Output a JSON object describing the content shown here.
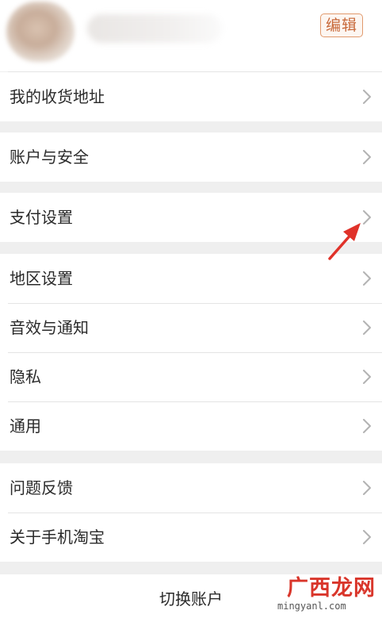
{
  "profile": {
    "edit_label": "编辑"
  },
  "menu": {
    "groups": [
      {
        "items": [
          {
            "label": "我的收货地址"
          }
        ]
      },
      {
        "items": [
          {
            "label": "账户与安全"
          }
        ]
      },
      {
        "items": [
          {
            "label": "支付设置"
          }
        ]
      },
      {
        "items": [
          {
            "label": "地区设置"
          },
          {
            "label": "音效与通知"
          },
          {
            "label": "隐私"
          },
          {
            "label": "通用"
          }
        ]
      },
      {
        "items": [
          {
            "label": "问题反馈"
          },
          {
            "label": "关于手机淘宝"
          }
        ]
      }
    ]
  },
  "footer": {
    "switch_account_label": "切换账户"
  },
  "watermark": {
    "brand": "广西龙网",
    "url": "mingyanl.com"
  },
  "colors": {
    "accent": "#e19a6d",
    "annotation_arrow": "#e0322a",
    "background": "#efefef",
    "panel": "#ffffff"
  }
}
